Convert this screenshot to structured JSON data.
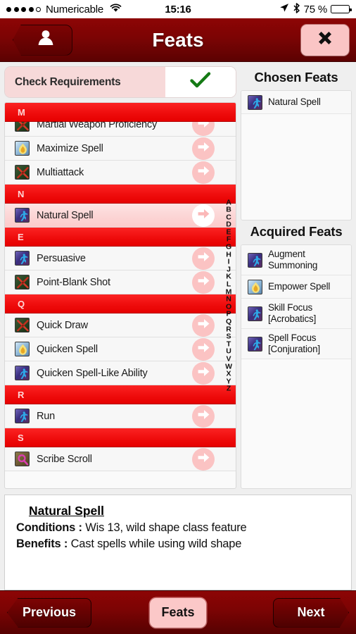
{
  "status_bar": {
    "signal_dots_filled": 4,
    "signal_dots_total": 5,
    "carrier": "Numericable",
    "wifi_icon": "wifi-icon",
    "time": "15:16",
    "location_icon": "location-arrow-icon",
    "bluetooth_icon": "bluetooth-icon",
    "battery_percent": "75 %",
    "battery_icon": "battery-icon",
    "battery_level": 75
  },
  "nav_bar": {
    "back_icon": "person-icon",
    "title": "Feats",
    "close_icon": "close-x-icon"
  },
  "check_requirements": {
    "label": "Check Requirements",
    "checked": true,
    "check_icon": "checkmark-icon",
    "check_color": "#1a7a1a"
  },
  "feat_list": {
    "sticky_header": "M",
    "alphabet_index": [
      "A",
      "B",
      "C",
      "D",
      "E",
      "F",
      "G",
      "H",
      "I",
      "J",
      "K",
      "L",
      "M",
      "N",
      "O",
      "P",
      "Q",
      "R",
      "S",
      "T",
      "U",
      "V",
      "W",
      "X",
      "Y",
      "Z"
    ],
    "rows": [
      {
        "type": "feat",
        "label": "",
        "icon": "sp-runner",
        "partial": true,
        "selected": false
      },
      {
        "type": "feat",
        "label": "Martial Weapon Proficiency",
        "icon": "sp-swords",
        "partial": false,
        "selected": false
      },
      {
        "type": "feat",
        "label": "Maximize Spell",
        "icon": "sp-flame",
        "partial": false,
        "selected": false
      },
      {
        "type": "feat",
        "label": "Multiattack",
        "icon": "sp-swords",
        "partial": false,
        "selected": false
      },
      {
        "type": "section",
        "label": "N"
      },
      {
        "type": "feat",
        "label": "Natural Spell",
        "icon": "sp-runner",
        "partial": false,
        "selected": true
      },
      {
        "type": "section",
        "label": "E"
      },
      {
        "type": "feat",
        "label": "Persuasive",
        "icon": "sp-runner",
        "partial": false,
        "selected": false
      },
      {
        "type": "feat",
        "label": "Point-Blank Shot",
        "icon": "sp-swords",
        "partial": false,
        "selected": false
      },
      {
        "type": "section",
        "label": "Q"
      },
      {
        "type": "feat",
        "label": "Quick Draw",
        "icon": "sp-swords",
        "partial": false,
        "selected": false
      },
      {
        "type": "feat",
        "label": "Quicken Spell",
        "icon": "sp-flame",
        "partial": false,
        "selected": false
      },
      {
        "type": "feat",
        "label": "Quicken Spell-Like Ability",
        "icon": "sp-runner",
        "partial": false,
        "selected": false
      },
      {
        "type": "section",
        "label": "R"
      },
      {
        "type": "feat",
        "label": "Run",
        "icon": "sp-runner",
        "partial": false,
        "selected": false
      },
      {
        "type": "section",
        "label": "S"
      },
      {
        "type": "feat",
        "label": "Scribe Scroll",
        "icon": "sp-scroll",
        "partial": false,
        "selected": false
      }
    ]
  },
  "chosen_feats": {
    "title": "Chosen Feats",
    "items": [
      {
        "label": "Natural Spell",
        "icon": "sp-runner"
      }
    ]
  },
  "acquired_feats": {
    "title": "Acquired Feats",
    "items": [
      {
        "label": "Augment Summoning",
        "icon": "sp-runner"
      },
      {
        "label": "Empower Spell",
        "icon": "sp-flame"
      },
      {
        "label": "Skill Focus [Acrobatics]",
        "icon": "sp-runner"
      },
      {
        "label": "Spell Focus [Conjuration]",
        "icon": "sp-runner"
      }
    ]
  },
  "description": {
    "title": "Natural Spell",
    "conditions_label": "Conditions :",
    "conditions_value": "Wis 13, wild shape class feature",
    "benefits_label": "Benefits :",
    "benefits_value": "Cast spells while using wild shape"
  },
  "toolbar": {
    "previous_label": "Previous",
    "center_label": "Feats",
    "next_label": "Next"
  }
}
